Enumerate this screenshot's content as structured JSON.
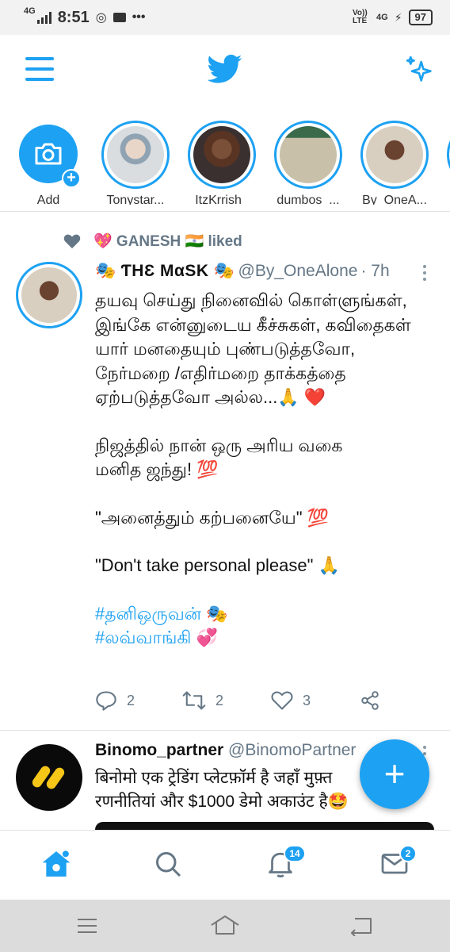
{
  "status_bar": {
    "network_label": "4G",
    "time": "8:51",
    "volte": "Vo)) LTE",
    "network_right": "4G",
    "battery": "97"
  },
  "fleets": [
    {
      "name": "Add"
    },
    {
      "name": "Tonystar..."
    },
    {
      "name": "ItzKrrish_"
    },
    {
      "name": "dumbos_..."
    },
    {
      "name": "By_OneA..."
    }
  ],
  "tweet": {
    "social_context": "💖 GANESH 🇮🇳 liked",
    "display_name": "🎭 ƬHƐ MαSK 🎭",
    "handle": "@By_OneAlone",
    "time": "· 7h",
    "paragraphs": [
      "தயவு செய்து நினைவில் கொள்ளுங்கள், இங்கே என்னுடைய கீச்சுகள், கவிதைகள் யார் மனதையும் புண்படுத்தவோ, நேர்மறை /எதிர்மறை தாக்கத்தை ஏற்படுத்தவோ அல்ல...🙏 ❤️",
      "நிஜத்தில் நான் ஒரு அரிய வகை மனித ஜந்து! 💯",
      "\"அனைத்தும் கற்பனையே\" 💯",
      "\"Don't take personal please\" 🙏"
    ],
    "hashtags": [
      "#தனிஒருவன் 🎭",
      "#லவ்வாங்கி 💞"
    ],
    "reply_count": "2",
    "retweet_count": "2",
    "like_count": "3"
  },
  "tweet2": {
    "display_name": "Binomo_partner",
    "handle": "@BinomoPartner",
    "line1": "बिनोमो एक ट्रेडिंग प्लेटफ़ॉर्म है जहाँ मुफ़्त",
    "line2": "रणनीतियां और $1000 डेमो अकाउंट है🤩"
  },
  "fab_label": "+",
  "bottom_nav": {
    "notifications_badge": "14",
    "messages_badge": "2"
  },
  "colors": {
    "accent": "#1da1f2",
    "secondary_text": "#657786"
  }
}
